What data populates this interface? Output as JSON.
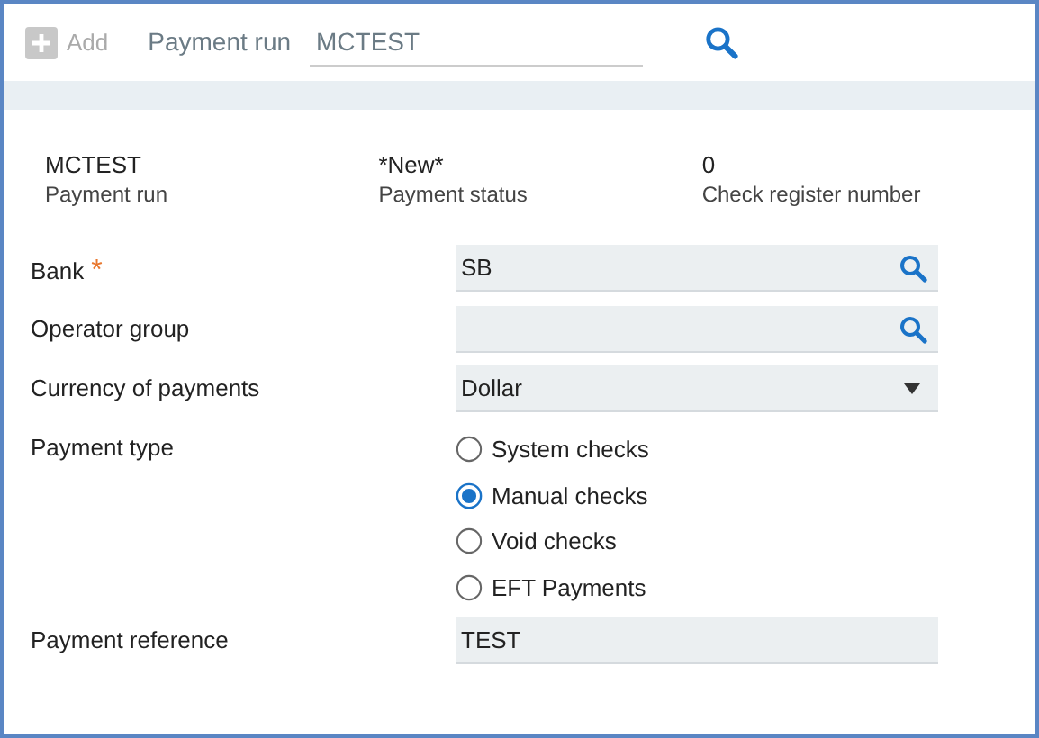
{
  "toolbar": {
    "add_button": {
      "label": "Add",
      "disabled": true
    },
    "run_label": "Payment run",
    "run_value": "MCTEST"
  },
  "summary": [
    {
      "value": "MCTEST",
      "label": "Payment run"
    },
    {
      "value": "*New*",
      "label": "Payment status"
    },
    {
      "value": "0",
      "label": "Check register number"
    }
  ],
  "fields": [
    {
      "label": "Bank",
      "kind": "lookup",
      "value": "SB",
      "required_mark": "*"
    },
    {
      "label": "Operator group",
      "kind": "lookup"
    },
    {
      "label": "Currency of payments",
      "kind": "select",
      "value": "Dollar"
    },
    {
      "label": "Payment type",
      "kind": "radio",
      "options": [
        {
          "label": "System checks",
          "selected": false
        },
        {
          "label": "Manual checks",
          "selected": true
        },
        {
          "label": "Void checks",
          "selected": false
        },
        {
          "label": "EFT Payments",
          "selected": false
        }
      ]
    },
    {
      "label": "Payment reference",
      "kind": "text",
      "value": "TEST"
    }
  ]
}
